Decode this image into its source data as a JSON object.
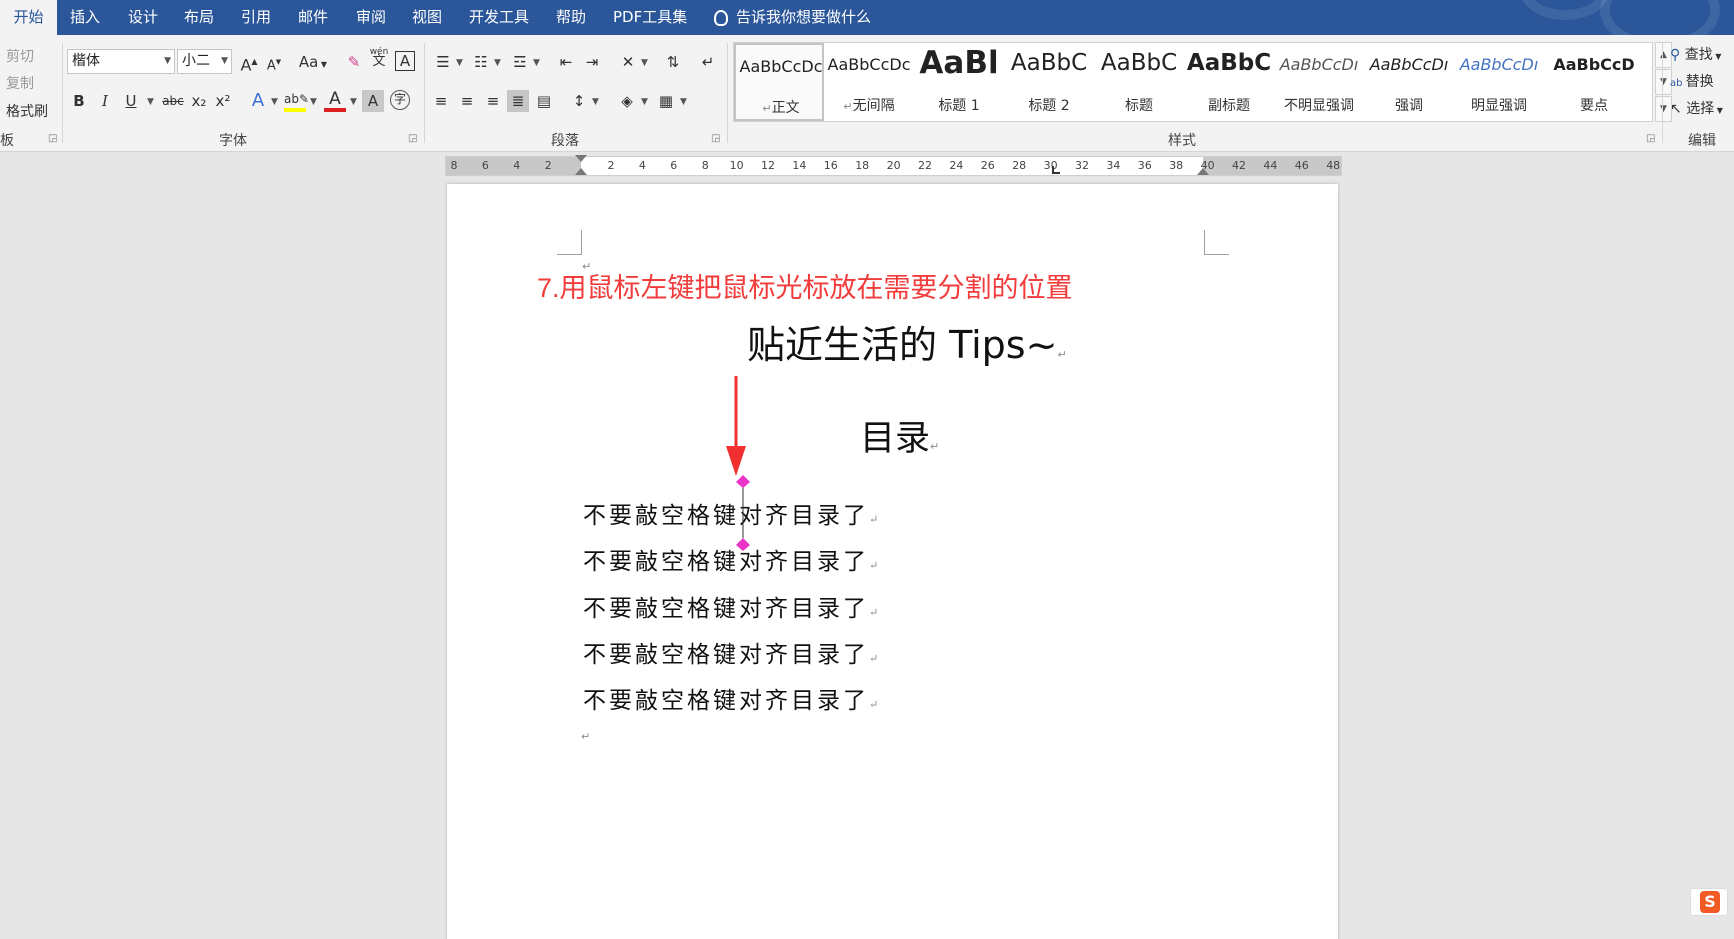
{
  "tabs": [
    {
      "label": "开始",
      "active": true
    },
    {
      "label": "插入"
    },
    {
      "label": "设计"
    },
    {
      "label": "布局"
    },
    {
      "label": "引用"
    },
    {
      "label": "邮件"
    },
    {
      "label": "审阅"
    },
    {
      "label": "视图"
    },
    {
      "label": "开发工具"
    },
    {
      "label": "帮助"
    },
    {
      "label": "PDF工具集"
    }
  ],
  "tell_me": {
    "text": "告诉我你想要做什么",
    "icon": "lightbulb-icon"
  },
  "clipboard": {
    "cut": "剪切",
    "copy": "复制",
    "format_painter": "格式刷",
    "group_label": "板"
  },
  "font": {
    "family": "楷体",
    "size": "小二",
    "change_case": "Aa",
    "bold": "B",
    "italic": "I",
    "underline": "U",
    "strike": "abc",
    "subscript": "x₂",
    "superscript": "x²",
    "phonetic": "wén",
    "phonetic_char": "文",
    "highlight_color": "#ffff00",
    "font_color": "#e02020",
    "group_label": "字体"
  },
  "paragraph": {
    "group_label": "段落"
  },
  "styles": {
    "group_label": "样式",
    "items": [
      {
        "sample": "AaBbCcDc",
        "name": "正文",
        "selected": true
      },
      {
        "sample": "AaBbCcDc",
        "name": "无间隔"
      },
      {
        "sample": "AaBl",
        "name": "标题 1"
      },
      {
        "sample": "AaBbC",
        "name": "标题 2"
      },
      {
        "sample": "AaBbC",
        "name": "标题"
      },
      {
        "sample": "AaBbC",
        "name": "副标题"
      },
      {
        "sample": "AaBbCcDı",
        "name": "不明显强调"
      },
      {
        "sample": "AaBbCcDı",
        "name": "强调"
      },
      {
        "sample": "AaBbCcDı",
        "name": "明显强调"
      },
      {
        "sample": "AaBbCcD",
        "name": "要点"
      }
    ]
  },
  "editing": {
    "find": "查找",
    "replace": "替换",
    "select": "选择",
    "group_label": "编辑"
  },
  "ruler": {
    "labels": [
      "8",
      "6",
      "4",
      "2",
      "",
      "2",
      "4",
      "6",
      "8",
      "10",
      "12",
      "14",
      "16",
      "18",
      "20",
      "22",
      "24",
      "26",
      "28",
      "30",
      "32",
      "34",
      "36",
      "38",
      "40",
      "42",
      "44",
      "46",
      "48"
    ]
  },
  "document": {
    "instruction": "7.用鼠标左键把鼠标光标放在需要分割的位置",
    "title": "贴近生活的 Tips~",
    "toc_heading": "目录",
    "lines": [
      "不要敲空格键对齐目录了",
      "不要敲空格键对齐目录了",
      "不要敲空格键对齐目录了",
      "不要敲空格键对齐目录了",
      "不要敲空格键对齐目录了"
    ],
    "paragraph_mark": "↵"
  },
  "colors": {
    "ribbon_blue": "#2b579a",
    "instruction_red": "#f23b3b",
    "arrow_red": "#f03030",
    "cursor_magenta": "#ec33c8"
  }
}
